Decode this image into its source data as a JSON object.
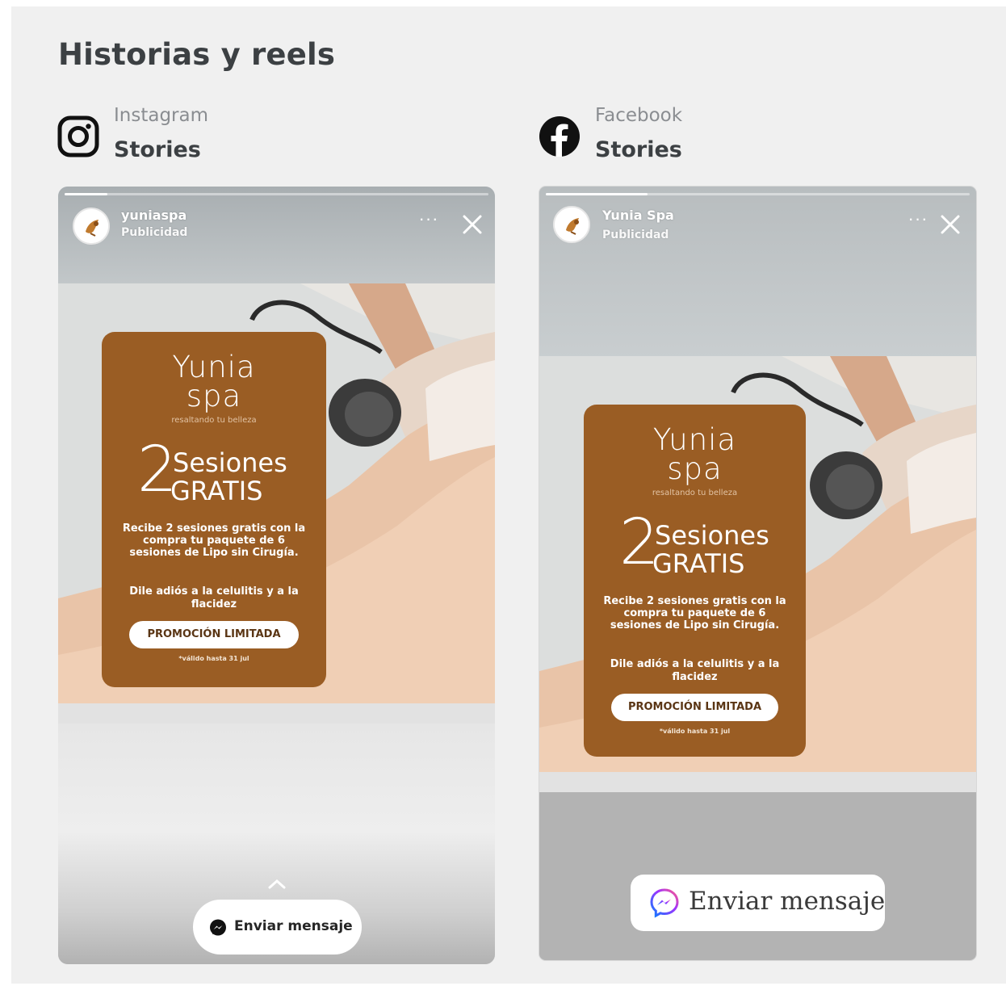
{
  "section": {
    "title": "Historias y reels"
  },
  "platforms": [
    {
      "name": "Instagram",
      "format": "Stories",
      "icon": "instagram-icon",
      "story": {
        "account": "yuniaspa",
        "sponsored": "Publicidad",
        "cta": "Enviar mensaje",
        "cta_icon": "messenger-icon"
      }
    },
    {
      "name": "Facebook",
      "format": "Stories",
      "icon": "facebook-icon",
      "story": {
        "account": "Yunia Spa",
        "sponsored": "Publicidad",
        "cta": "Enviar mensaje",
        "cta_icon": "messenger-icon"
      }
    }
  ],
  "ad": {
    "brand_line1": "Yunia",
    "brand_line2": "spa",
    "tagline": "resaltando tu belleza",
    "offer_number": "2",
    "offer_line1": "Sesiones",
    "offer_line2": "GRATIS",
    "description": "Recibe 2 sesiones gratis con la compra tu paquete de 6 sesiones de Lipo sin Cirugía.",
    "description2": "Dile adiós a la celulitis y a la flacidez",
    "cta": "PROMOCIÓN LIMITADA",
    "note": "*válido hasta 31 jul"
  },
  "colors": {
    "panel_bg": "#f0f0f0",
    "promo_brown": "#9a5d24",
    "messenger_purple": "#8a3ffc",
    "messenger_blue": "#0a7cff"
  }
}
